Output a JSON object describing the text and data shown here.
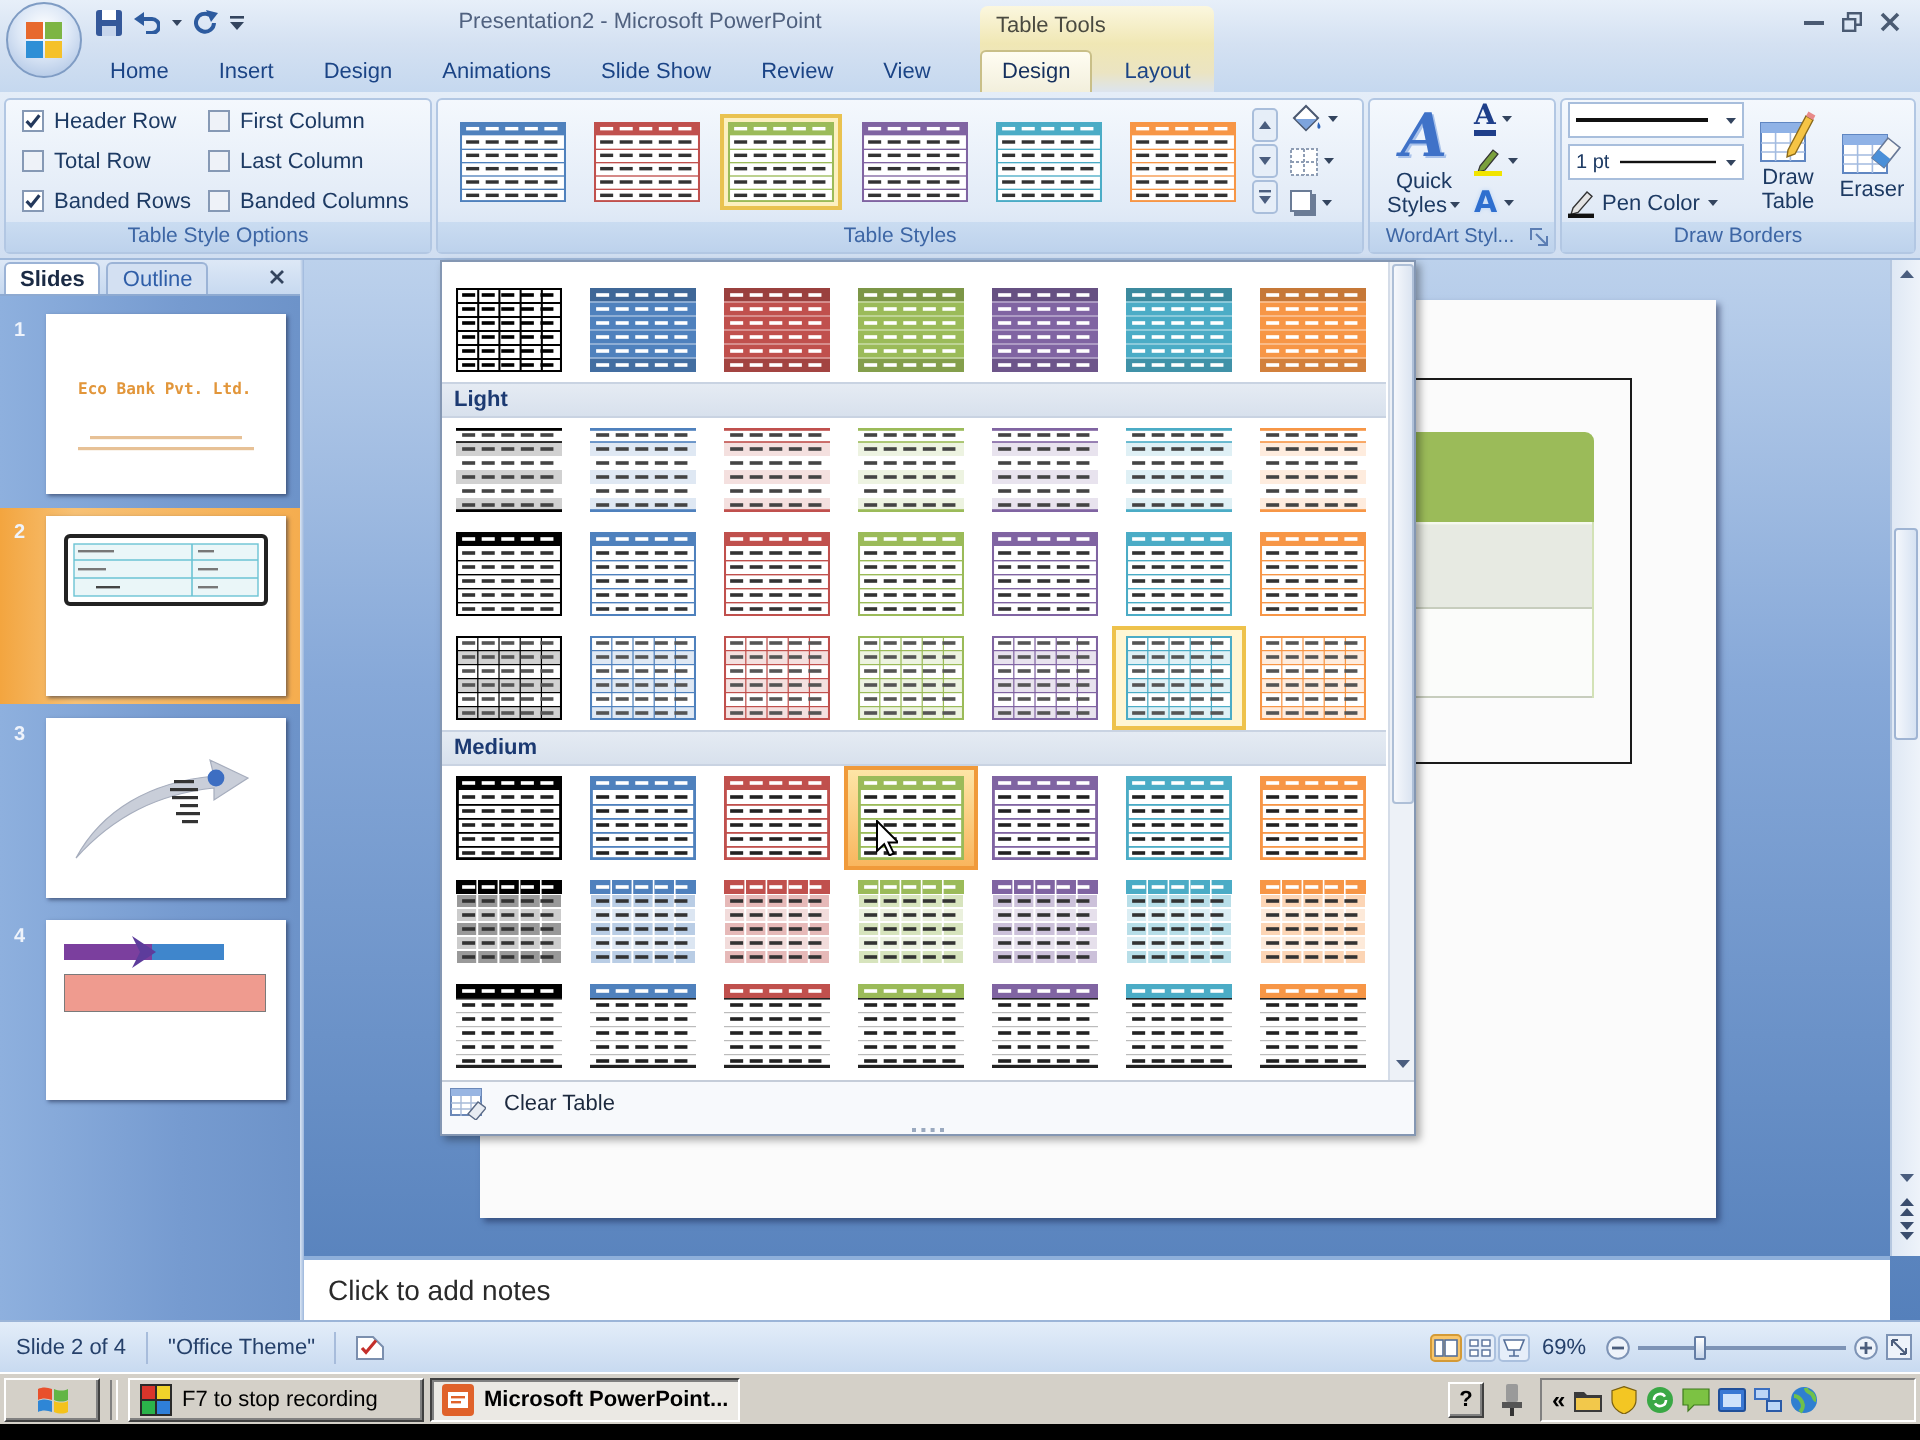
{
  "title_bar": {
    "title": "Presentation2 - Microsoft PowerPoint",
    "contextual_label": "Table Tools"
  },
  "tabs": [
    {
      "label": "Home",
      "selected": false
    },
    {
      "label": "Insert",
      "selected": false
    },
    {
      "label": "Design",
      "selected": false
    },
    {
      "label": "Animations",
      "selected": false
    },
    {
      "label": "Slide Show",
      "selected": false
    },
    {
      "label": "Review",
      "selected": false
    },
    {
      "label": "View",
      "selected": false
    }
  ],
  "contextual_tabs": [
    {
      "label": "Design",
      "selected": true
    },
    {
      "label": "Layout",
      "selected": false
    }
  ],
  "ribbon": {
    "table_style_options": {
      "label": "Table Style Options",
      "options": [
        {
          "label": "Header Row",
          "checked": true
        },
        {
          "label": "Total Row",
          "checked": false
        },
        {
          "label": "Banded Rows",
          "checked": true
        },
        {
          "label": "First Column",
          "checked": false
        },
        {
          "label": "Last Column",
          "checked": false
        },
        {
          "label": "Banded Columns",
          "checked": false
        }
      ]
    },
    "table_styles": {
      "label": "Table Styles",
      "styles": [
        {
          "kind": "light-header",
          "color": "#4f81bd",
          "selected": false
        },
        {
          "kind": "light-header",
          "color": "#c0504d",
          "selected": false
        },
        {
          "kind": "light-header",
          "color": "#9bbb59",
          "selected": true
        },
        {
          "kind": "light-header",
          "color": "#8064a2",
          "selected": false
        },
        {
          "kind": "light-header",
          "color": "#4bacc6",
          "selected": false
        },
        {
          "kind": "light-header",
          "color": "#f79646",
          "selected": false
        }
      ]
    },
    "wordart_styles": {
      "label": "WordArt Styl...",
      "glyph": "A",
      "quick_styles": "Quick Styles",
      "text_fill_glyph": "A",
      "text_effects_glyph": "A"
    },
    "draw_borders": {
      "label": "Draw Borders",
      "pen_weight": "1 pt",
      "pen_color": "Pen Color",
      "draw_table": "Draw Table",
      "eraser": "Eraser"
    }
  },
  "slides_panel": {
    "tabs": [
      {
        "label": "Slides",
        "selected": true
      },
      {
        "label": "Outline",
        "selected": false
      }
    ],
    "slides": [
      {
        "number": "1",
        "kind": "title",
        "title": "Eco Bank Pvt. Ltd.",
        "selected": false
      },
      {
        "number": "2",
        "kind": "table",
        "selected": true
      },
      {
        "number": "3",
        "kind": "arrow",
        "selected": false
      },
      {
        "number": "4",
        "kind": "bars",
        "selected": false
      }
    ]
  },
  "gallery": {
    "sections": [
      {
        "rows": [
          {
            "swatches": [
              {
                "kind": "grid",
                "color": "#000000",
                "selected": false,
                "hovered": false
              },
              {
                "kind": "solid",
                "color": "#4f81bd",
                "selected": false,
                "hovered": false
              },
              {
                "kind": "solid",
                "color": "#c0504d",
                "selected": false,
                "hovered": false
              },
              {
                "kind": "solid",
                "color": "#9bbb59",
                "selected": false,
                "hovered": false
              },
              {
                "kind": "solid",
                "color": "#8064a2",
                "selected": false,
                "hovered": false
              },
              {
                "kind": "solid",
                "color": "#4bacc6",
                "selected": false,
                "hovered": false
              },
              {
                "kind": "solid",
                "color": "#f79646",
                "selected": false,
                "hovered": false
              }
            ]
          }
        ]
      },
      {
        "heading": "Light",
        "rows": [
          {
            "swatches": [
              {
                "kind": "light-lines",
                "color": "#000000",
                "selected": false,
                "hovered": false
              },
              {
                "kind": "light-lines",
                "color": "#4f81bd",
                "selected": false,
                "hovered": false
              },
              {
                "kind": "light-lines",
                "color": "#c0504d",
                "selected": false,
                "hovered": false
              },
              {
                "kind": "light-lines",
                "color": "#9bbb59",
                "selected": false,
                "hovered": false
              },
              {
                "kind": "light-lines",
                "color": "#8064a2",
                "selected": false,
                "hovered": false
              },
              {
                "kind": "light-lines",
                "color": "#4bacc6",
                "selected": false,
                "hovered": false
              },
              {
                "kind": "light-lines",
                "color": "#f79646",
                "selected": false,
                "hovered": false
              }
            ]
          },
          {
            "swatches": [
              {
                "kind": "light-header",
                "color": "#000000",
                "selected": false,
                "hovered": false
              },
              {
                "kind": "light-header",
                "color": "#4f81bd",
                "selected": false,
                "hovered": false
              },
              {
                "kind": "light-header",
                "color": "#c0504d",
                "selected": false,
                "hovered": false
              },
              {
                "kind": "light-header",
                "color": "#9bbb59",
                "selected": false,
                "hovered": false
              },
              {
                "kind": "light-header",
                "color": "#8064a2",
                "selected": false,
                "hovered": false
              },
              {
                "kind": "light-header",
                "color": "#4bacc6",
                "selected": false,
                "hovered": false
              },
              {
                "kind": "light-header",
                "color": "#f79646",
                "selected": false,
                "hovered": false
              }
            ]
          },
          {
            "swatches": [
              {
                "kind": "light-grid",
                "color": "#000000",
                "selected": false,
                "hovered": false
              },
              {
                "kind": "light-grid",
                "color": "#4f81bd",
                "selected": false,
                "hovered": false
              },
              {
                "kind": "light-grid",
                "color": "#c0504d",
                "selected": false,
                "hovered": false
              },
              {
                "kind": "light-grid",
                "color": "#9bbb59",
                "selected": false,
                "hovered": false
              },
              {
                "kind": "light-grid",
                "color": "#8064a2",
                "selected": false,
                "hovered": false
              },
              {
                "kind": "light-grid",
                "color": "#4bacc6",
                "selected": true,
                "hovered": false
              },
              {
                "kind": "light-grid",
                "color": "#f79646",
                "selected": false,
                "hovered": false
              }
            ]
          }
        ]
      },
      {
        "heading": "Medium",
        "rows": [
          {
            "swatches": [
              {
                "kind": "medium-header",
                "color": "#000000",
                "selected": false,
                "hovered": false
              },
              {
                "kind": "medium-header",
                "color": "#4f81bd",
                "selected": false,
                "hovered": false
              },
              {
                "kind": "medium-header",
                "color": "#c0504d",
                "selected": false,
                "hovered": false
              },
              {
                "kind": "medium-header",
                "color": "#9bbb59",
                "selected": false,
                "hovered": true
              },
              {
                "kind": "medium-header",
                "color": "#8064a2",
                "selected": false,
                "hovered": false
              },
              {
                "kind": "medium-header",
                "color": "#4bacc6",
                "selected": false,
                "hovered": false
              },
              {
                "kind": "medium-header",
                "color": "#f79646",
                "selected": false,
                "hovered": false
              }
            ]
          },
          {
            "swatches": [
              {
                "kind": "medium-banded",
                "color": "#000000",
                "selected": false,
                "hovered": false
              },
              {
                "kind": "medium-banded",
                "color": "#4f81bd",
                "selected": false,
                "hovered": false
              },
              {
                "kind": "medium-banded",
                "color": "#c0504d",
                "selected": false,
                "hovered": false
              },
              {
                "kind": "medium-banded",
                "color": "#9bbb59",
                "selected": false,
                "hovered": false
              },
              {
                "kind": "medium-banded",
                "color": "#8064a2",
                "selected": false,
                "hovered": false
              },
              {
                "kind": "medium-banded",
                "color": "#4bacc6",
                "selected": false,
                "hovered": false
              },
              {
                "kind": "medium-banded",
                "color": "#f79646",
                "selected": false,
                "hovered": false
              }
            ]
          },
          {
            "swatches": [
              {
                "kind": "medium-plain",
                "color": "#000000",
                "selected": false,
                "hovered": false
              },
              {
                "kind": "medium-plain",
                "color": "#4f81bd",
                "selected": false,
                "hovered": false
              },
              {
                "kind": "medium-plain",
                "color": "#c0504d",
                "selected": false,
                "hovered": false
              },
              {
                "kind": "medium-plain",
                "color": "#9bbb59",
                "selected": false,
                "hovered": false
              },
              {
                "kind": "medium-plain",
                "color": "#8064a2",
                "selected": false,
                "hovered": false
              },
              {
                "kind": "medium-plain",
                "color": "#4bacc6",
                "selected": false,
                "hovered": false
              },
              {
                "kind": "medium-plain",
                "color": "#f79646",
                "selected": false,
                "hovered": false
              }
            ]
          }
        ]
      }
    ],
    "clear_label": "Clear Table"
  },
  "notes": {
    "placeholder": "Click to add notes"
  },
  "status_bar": {
    "slide": "Slide 2 of 4",
    "theme": "\"Office Theme\"",
    "views": [
      {
        "kind": "normal",
        "selected": true
      },
      {
        "kind": "sorter",
        "selected": false
      },
      {
        "kind": "show",
        "selected": false
      }
    ],
    "zoom": {
      "reading": "69%",
      "level": 0.3
    }
  },
  "taskbar": {
    "buttons": [
      {
        "kind": "recorder",
        "label": "F7 to stop recording",
        "selected": false
      },
      {
        "kind": "powerpoint",
        "label": "Microsoft PowerPoint...",
        "selected": true
      }
    ],
    "help": "?",
    "tray_expand": "«"
  }
}
